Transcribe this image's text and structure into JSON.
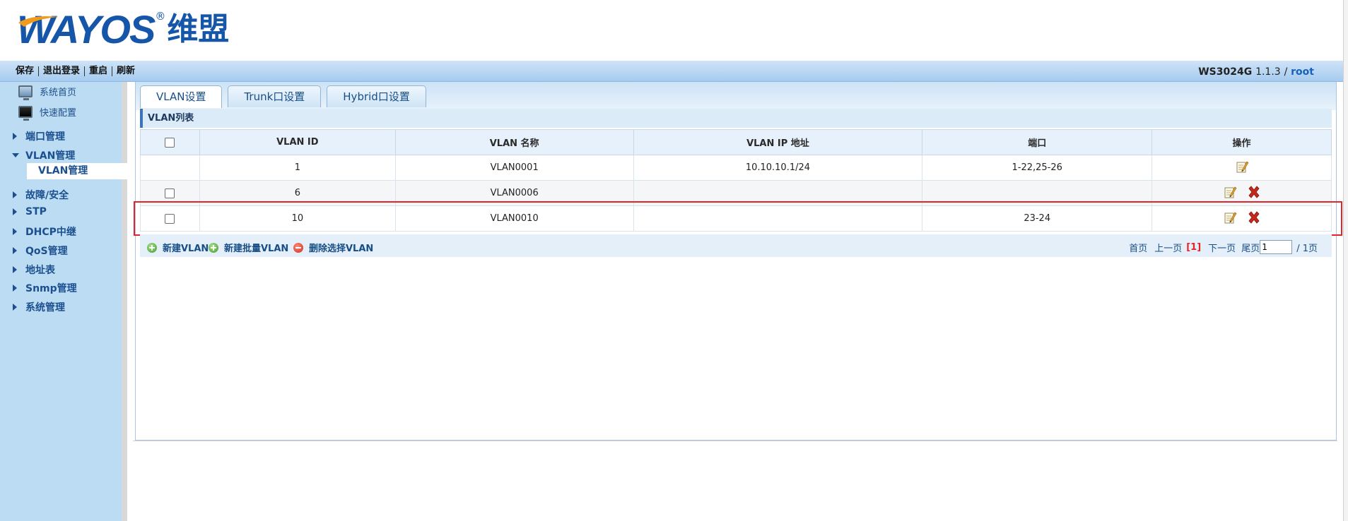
{
  "brand": {
    "latin": "WAYOS",
    "registered": "®",
    "chinese": "维盟"
  },
  "toolbar": {
    "links": [
      "保存",
      "退出登录",
      "重启",
      "刷新"
    ],
    "model": "WS3024G",
    "version": "1.1.3",
    "separator": "/",
    "user": "root"
  },
  "sidebar": {
    "subitems": [
      {
        "label": "系统首页",
        "icon": "home-monitor-icon"
      },
      {
        "label": "快速配置",
        "icon": "quick-config-monitor-icon"
      }
    ],
    "items": [
      "端口管理",
      "VLAN管理",
      "故障/安全",
      "STP",
      "DHCP中继",
      "QoS管理",
      "地址表",
      "Snmp管理",
      "系统管理"
    ],
    "expanded_child": "VLAN管理"
  },
  "tabs": [
    "VLAN设置",
    "Trunk口设置",
    "Hybrid口设置"
  ],
  "list_title": "VLAN列表",
  "table": {
    "headers": [
      "VLAN ID",
      "VLAN 名称",
      "VLAN IP 地址",
      "端口",
      "操作"
    ],
    "rows": [
      {
        "id": "1",
        "name": "VLAN0001",
        "ip": "10.10.10.1/24",
        "ports": "1-22,25-26",
        "checkbox": false,
        "deletable": false
      },
      {
        "id": "6",
        "name": "VLAN0006",
        "ip": "",
        "ports": "",
        "checkbox": true,
        "deletable": true
      },
      {
        "id": "10",
        "name": "VLAN0010",
        "ip": "",
        "ports": "23-24",
        "checkbox": true,
        "deletable": true
      }
    ]
  },
  "actions": {
    "new_vlan": "新建VLAN",
    "new_batch_vlan": "新建批量VLAN",
    "delete_selected": "删除选择VLAN"
  },
  "pager": {
    "first": "首页",
    "prev": "上一页",
    "current": "[1]",
    "next": "下一页",
    "last": "尾页",
    "input_value": "1",
    "total": "/ 1页"
  },
  "colors": {
    "brand": "#1656a8",
    "sidebar_bg": "#bcdcf3",
    "highlight": "#e0262a",
    "link": "#174e86"
  }
}
